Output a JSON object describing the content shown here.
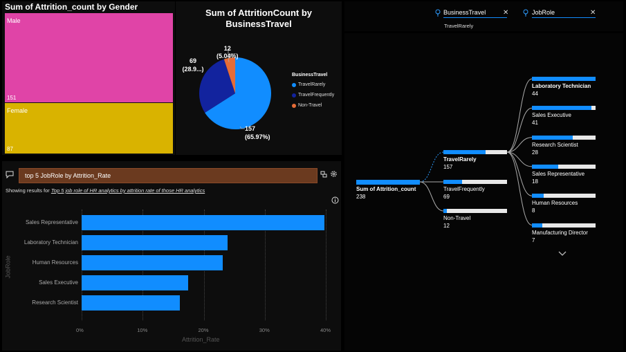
{
  "gender_visual": {
    "title": "Sum of Attrition_count by Gender",
    "male": {
      "label": "Male",
      "value": "151",
      "color": "#e044a7"
    },
    "female": {
      "label": "Female",
      "value": "87",
      "color": "#d9b300"
    }
  },
  "pie_visual": {
    "title_line1": "Sum of AttritionCount by",
    "title_line2": "BusinessTravel",
    "legend_title": "BusinessTravel",
    "legend": [
      {
        "label": "TravelRarely",
        "color": "#118dff"
      },
      {
        "label": "TravelFrequently",
        "color": "#12239e"
      },
      {
        "label": "Non-Travel",
        "color": "#e66c37"
      }
    ],
    "labels": {
      "rarely_value": "157",
      "rarely_pct": "(65.97%)",
      "freq_value": "69",
      "freq_pct": "(28.9...)",
      "non_value": "12",
      "non_pct": "(5.04%)"
    }
  },
  "qa_visual": {
    "question": "top 5 JobRole by Attrition_Rate",
    "showing_prefix": "Showing results for",
    "showing_query": "Top 5 job role of HR analytics by attrition rate of those HR analytics",
    "x_title": "Attrition_Rate",
    "y_title": "JobRole"
  },
  "filters": {
    "f1_label": "BusinessTravel",
    "f1_value": "TravelRarely",
    "f2_label": "JobRole"
  },
  "decomp": {
    "root_name": "Sum of Attrition_count",
    "root_value": "238",
    "level1": [
      {
        "name": "TravelRarely",
        "value": "157"
      },
      {
        "name": "TravelFrequently",
        "value": "69"
      },
      {
        "name": "Non-Travel",
        "value": "12"
      }
    ],
    "level2": [
      {
        "name": "Laboratory Technician",
        "value": "44"
      },
      {
        "name": "Sales Executive",
        "value": "41"
      },
      {
        "name": "Research Scientist",
        "value": "28"
      },
      {
        "name": "Sales Representative",
        "value": "18"
      },
      {
        "name": "Human Resources",
        "value": "8"
      },
      {
        "name": "Manufacturing Director",
        "value": "7"
      }
    ]
  },
  "chart_data": [
    {
      "type": "pie",
      "title": "Sum of AttritionCount by BusinessTravel",
      "categories": [
        "TravelRarely",
        "TravelFrequently",
        "Non-Travel"
      ],
      "values": [
        157,
        69,
        12
      ],
      "data_labels": [
        "157 (65.97%)",
        "69 (28.9...)",
        "12 (5.04%)"
      ],
      "legend_position": "right"
    },
    {
      "type": "bar",
      "orientation": "horizontal",
      "categories": [
        "Sales Representative",
        "Laboratory Technician",
        "Human Resources",
        "Sales Executive",
        "Research Scientist"
      ],
      "values": [
        0.398,
        0.239,
        0.231,
        0.175,
        0.161
      ],
      "xlabel": "Attrition_Rate",
      "ylabel": "JobRole",
      "xlim": [
        0,
        0.4
      ],
      "x_ticks": [
        "0%",
        "10%",
        "20%",
        "30%",
        "40%"
      ],
      "grid": true
    },
    {
      "type": "treemap",
      "title": "Sum of Attrition_count by Gender",
      "categories": [
        "Male",
        "Female"
      ],
      "values": [
        151,
        87
      ]
    }
  ]
}
